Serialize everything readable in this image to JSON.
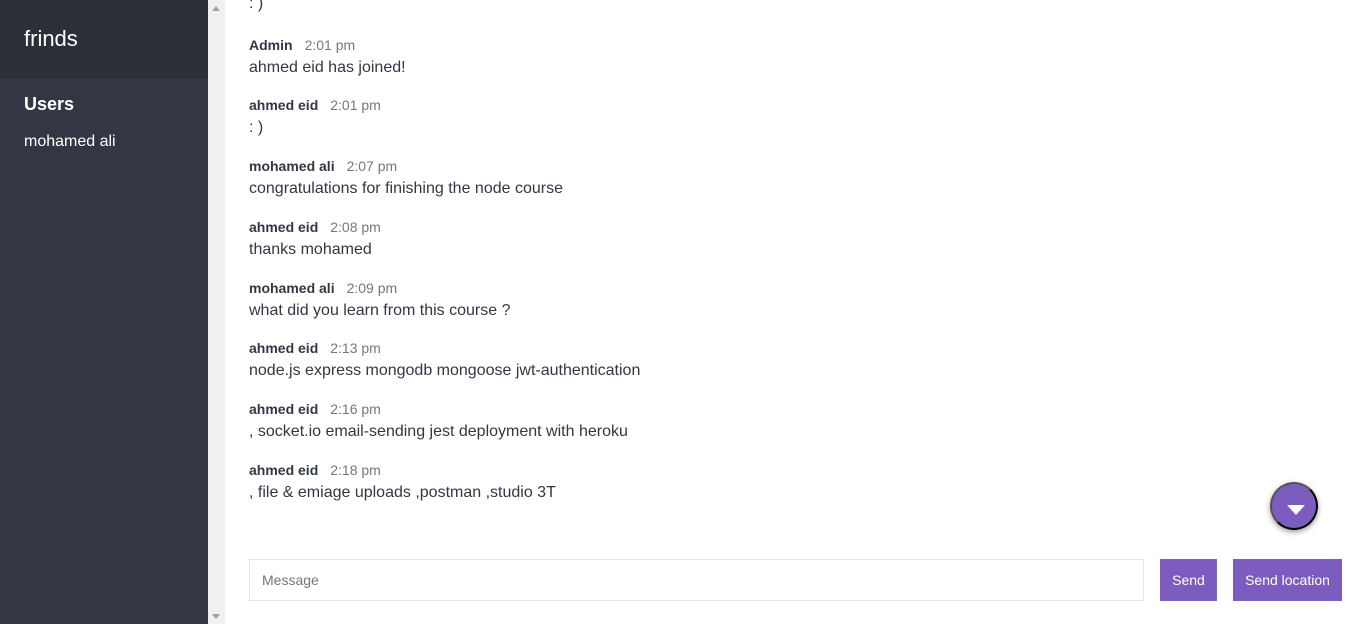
{
  "sidebar": {
    "room_title": "frinds",
    "list_title": "Users",
    "users": [
      "mohamed ali"
    ]
  },
  "messages": {
    "partial_text": ": )",
    "items": [
      {
        "name": "Admin",
        "time": "2:01 pm",
        "text": "ahmed eid has joined!"
      },
      {
        "name": "ahmed eid",
        "time": "2:01 pm",
        "text": ": )"
      },
      {
        "name": "mohamed ali",
        "time": "2:07 pm",
        "text": "congratulations for finishing the node course"
      },
      {
        "name": "ahmed eid",
        "time": "2:08 pm",
        "text": "thanks mohamed"
      },
      {
        "name": "mohamed ali",
        "time": "2:09 pm",
        "text": "what did you learn from this course ?"
      },
      {
        "name": "ahmed eid",
        "time": "2:13 pm",
        "text": "node.js express mongodb mongoose jwt-authentication"
      },
      {
        "name": "ahmed eid",
        "time": "2:16 pm",
        "text": ", socket.io email-sending jest deployment with heroku"
      },
      {
        "name": "ahmed eid",
        "time": "2:18 pm",
        "text": ", file & emiage uploads ,postman ,studio 3T"
      }
    ]
  },
  "compose": {
    "placeholder": "Message",
    "value": "",
    "send_label": "Send",
    "location_label": "Send location"
  },
  "colors": {
    "accent": "#7c5cbf",
    "sidebar_bg": "#333744",
    "header_bg": "#2c2e38"
  },
  "icons": {
    "scroll_down": "caret-down-icon"
  }
}
